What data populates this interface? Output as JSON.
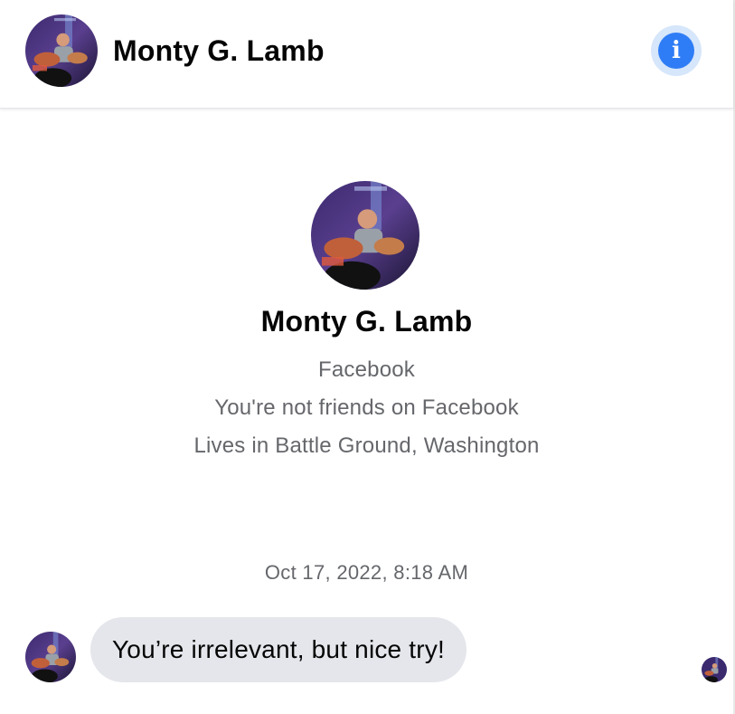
{
  "header": {
    "contact_name": "Monty G. Lamb",
    "info_icon": "info-icon",
    "avatar_icon": "profile-photo"
  },
  "profile": {
    "name": "Monty G. Lamb",
    "platform": "Facebook",
    "friend_status": "You're not friends on Facebook",
    "location": "Lives in Battle Ground, Washington"
  },
  "conversation": {
    "timestamp": "Oct 17, 2022, 8:18 AM",
    "messages": [
      {
        "sender": "Monty G. Lamb",
        "text": "You’re irrelevant, but nice try!"
      }
    ]
  },
  "colors": {
    "accent": "#2f7df6",
    "accent_soft": "#d6e6fb",
    "bubble_bg": "#e4e6eb",
    "secondary_text": "#65676b",
    "primary_text": "#050505"
  }
}
